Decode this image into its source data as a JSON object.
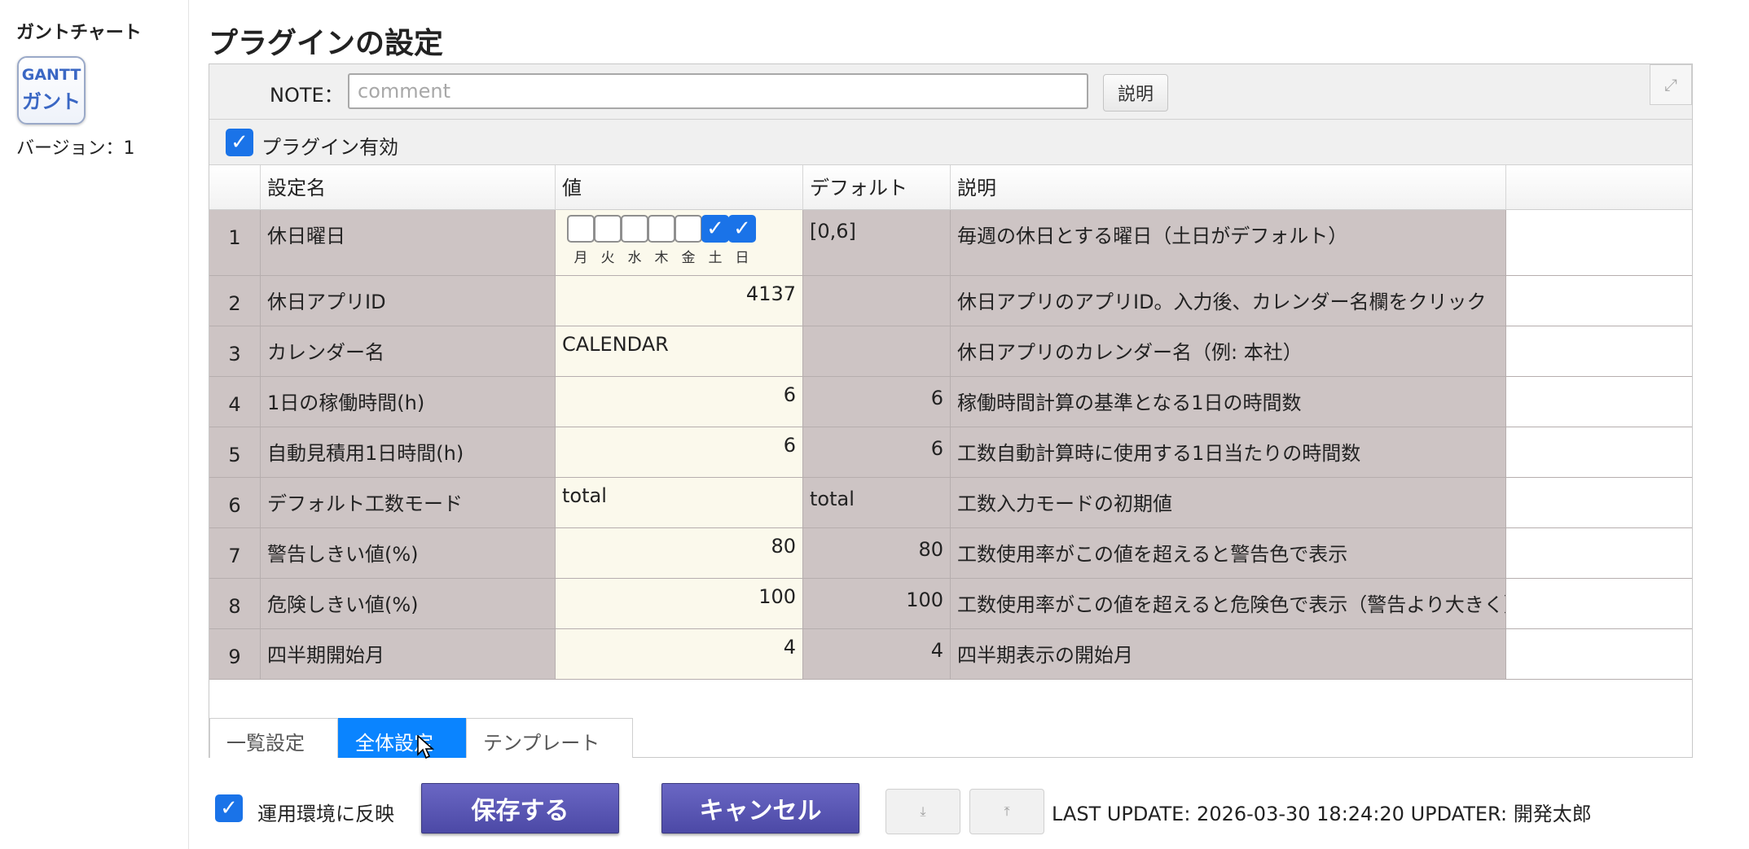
{
  "sidebar": {
    "title": "ガントチャート",
    "icon_line1": "GANTT",
    "icon_line2": "ガント",
    "version": "バージョン：1"
  },
  "page_title": "プラグインの設定",
  "note": {
    "label": "NOTE：",
    "placeholder": "comment",
    "value": "",
    "help_label": "説明",
    "expand_icon": "⤢"
  },
  "plugin_enabled": {
    "label": "プラグイン有効",
    "checked": true
  },
  "grid": {
    "headers": [
      "設定名",
      "値",
      "デフォルト",
      "説明"
    ],
    "weekday_labels": [
      "月",
      "火",
      "水",
      "木",
      "金",
      "土",
      "日"
    ],
    "weekday_checked": [
      false,
      false,
      false,
      false,
      false,
      true,
      true
    ],
    "rows": [
      {
        "num": "1",
        "name": "休日曜日",
        "value": "",
        "default": "[0,6]",
        "desc": "毎週の休日とする曜日（土日がデフォルト）"
      },
      {
        "num": "2",
        "name": "休日アプリID",
        "value": "4137",
        "default": "",
        "desc": "休日アプリのアプリID。入力後、カレンダー名欄をクリック"
      },
      {
        "num": "3",
        "name": "カレンダー名",
        "value": "CALENDAR",
        "default": "",
        "desc": "休日アプリのカレンダー名（例: 本社）"
      },
      {
        "num": "4",
        "name": "1日の稼働時間(h)",
        "value": "6",
        "default": "6",
        "desc": "稼働時間計算の基準となる1日の時間数"
      },
      {
        "num": "5",
        "name": "自動見積用1日時間(h)",
        "value": "6",
        "default": "6",
        "desc": "工数自動計算時に使用する1日当たりの時間数"
      },
      {
        "num": "6",
        "name": "デフォルト工数モード",
        "value": "total",
        "default": "total",
        "desc": "工数入力モードの初期値"
      },
      {
        "num": "7",
        "name": "警告しきい値(%)",
        "value": "80",
        "default": "80",
        "desc": "工数使用率がこの値を超えると警告色で表示"
      },
      {
        "num": "8",
        "name": "危険しきい値(%)",
        "value": "100",
        "default": "100",
        "desc": "工数使用率がこの値を超えると危険色で表示（警告より大きく）"
      },
      {
        "num": "9",
        "name": "四半期開始月",
        "value": "4",
        "default": "4",
        "desc": "四半期表示の開始月"
      }
    ]
  },
  "tabs": [
    {
      "label": "一覧設定",
      "active": false
    },
    {
      "label": "全体設定",
      "active": true
    },
    {
      "label": "テンプレート",
      "active": false
    }
  ],
  "footer": {
    "reflect_label": "運用環境に反映",
    "reflect_checked": true,
    "save_label": "保存する",
    "cancel_label": "キャンセル",
    "download_icon": "⤓",
    "upload_icon": "⤒",
    "last_update": "LAST UPDATE: 2026-03-30 18:24:20 UPDATER: 開発太郎"
  },
  "colors": {
    "accent": "#1a73e8",
    "tab_active": "#0a84ff",
    "button_primary": "#5653b5",
    "row_bg": "#cdc4c4",
    "value_bg": "#fbf9ec"
  }
}
